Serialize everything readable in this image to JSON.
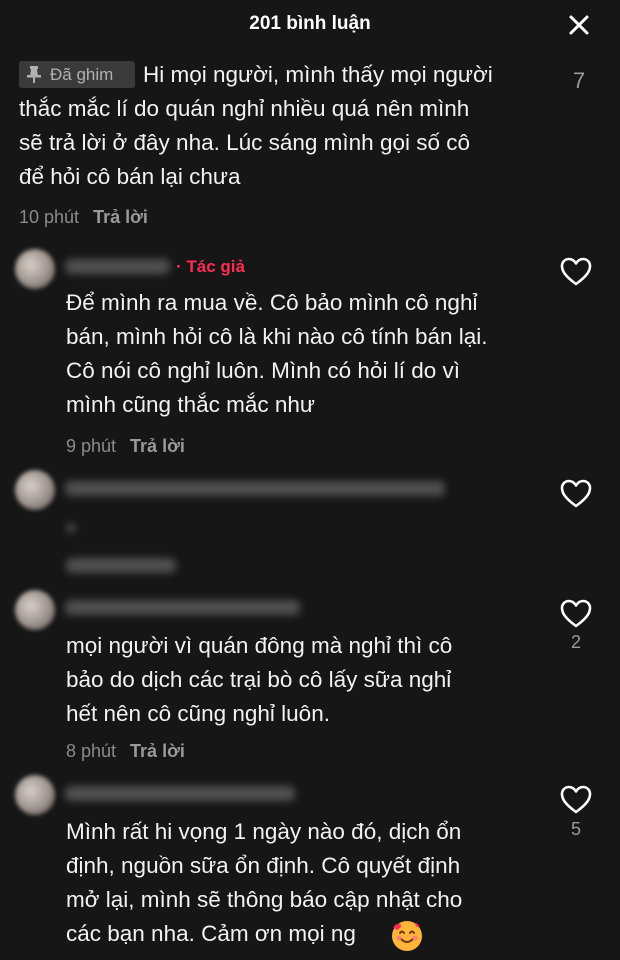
{
  "header": {
    "title": "201 bình luận"
  },
  "pinned": {
    "badge": "Đã ghim",
    "text": "Hi mọi người, mình thấy mọi người\nthắc mắc lí do quán nghỉ nhiều quá nên mình\nsẽ trả lời ở đây nha. Lúc sáng mình gọi số cô\nđể hỏi cô bán lại chưa",
    "time": "10 phút",
    "reply": "Trả lời",
    "likes": "7"
  },
  "comments": [
    {
      "author_tag": "· Tác giả",
      "text": "Để mình ra mua về. Cô bảo mình cô nghỉ\nbán, mình hỏi cô là khi nào cô tính bán lại.\nCô nói cô nghỉ luôn. Mình có hỏi lí do vì\nmình cũng thắc mắc như",
      "time": "9 phút",
      "reply": "Trả lời"
    },
    {
      "text": "mọi người vì quán đông mà nghỉ thì cô\nbảo do dịch các trại bò cô lấy sữa nghỉ\nhết nên cô cũng nghỉ luôn.",
      "time": "8 phút",
      "reply": "Trả lời",
      "likes": "2"
    },
    {
      "text": "Mình rất hi vọng 1 ngày nào đó, dịch ổn\nđịnh, nguồn sữa ổn định. Cô quyết định\nmở lại, mình sẽ thông báo cập nhật cho\ncác bạn nha. Cảm ơn mọi ng",
      "likes": "5"
    }
  ],
  "icons": {
    "close": "close-icon",
    "pin": "pin-icon",
    "heart": "heart-outline-icon",
    "emoji": "smiling-face-with-hearts-emoji"
  },
  "colors": {
    "background": "#161616",
    "author_tag": "#fe2c55",
    "muted_text": "#8a8a8a"
  }
}
